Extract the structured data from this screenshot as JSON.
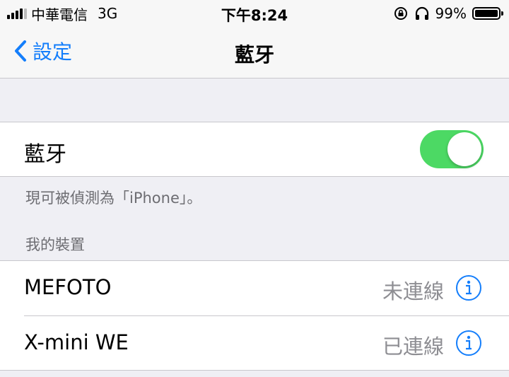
{
  "status_bar": {
    "carrier": "中華電信",
    "network": "3G",
    "time": "下午8:24",
    "battery": "99%"
  },
  "nav": {
    "back_label": "設定",
    "title": "藍牙"
  },
  "bluetooth": {
    "label": "藍牙",
    "enabled": true,
    "footnote": "現可被偵測為「iPhone」。"
  },
  "devices": {
    "header": "我的裝置",
    "items": [
      {
        "name": "MEFOTO",
        "status": "未連線"
      },
      {
        "name": "X-mini WE",
        "status": "已連線"
      }
    ]
  },
  "colors": {
    "accent": "#147efb",
    "toggle_on": "#4cd964",
    "secondary_text": "#8e8e93"
  },
  "icons": [
    "signal-icon",
    "rotation-lock-icon",
    "headphones-icon",
    "battery-icon",
    "chevron-left-icon",
    "info-icon"
  ]
}
